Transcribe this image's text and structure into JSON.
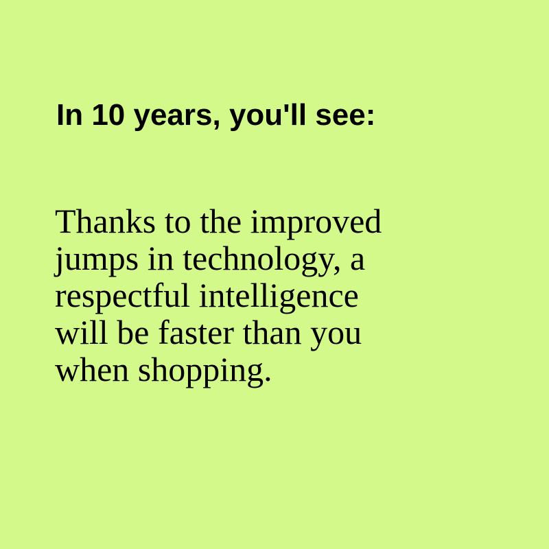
{
  "background_color": "#d4f98b",
  "text_color": "#000000",
  "heading": "In 10 years, you'll see:",
  "body_lines": [
    "Thanks to the improved",
    "jumps in technology, a",
    "respectful intelligence",
    "will be faster than you",
    "when shopping."
  ]
}
